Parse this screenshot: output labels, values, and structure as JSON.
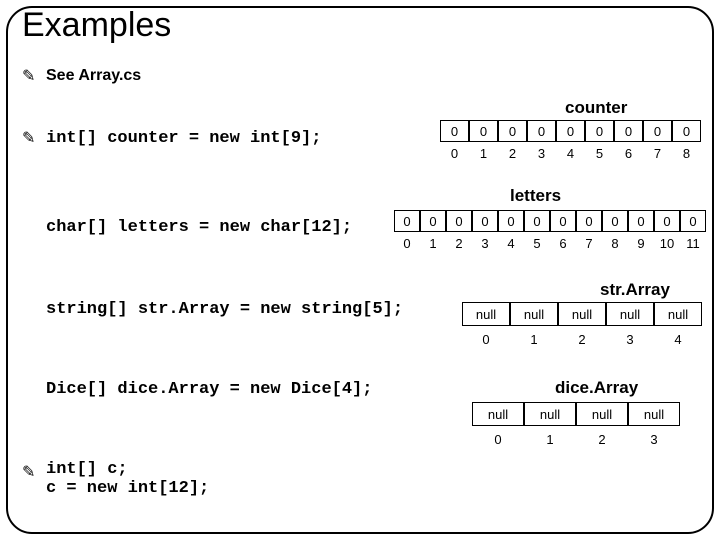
{
  "title": "Examples",
  "bullets": {
    "see": "See Array.cs",
    "code1": "int[] counter = new int[9];",
    "code2": "char[] letters = new char[12];",
    "code3": "string[] str.Array = new string[5];",
    "code4": "Dice[] dice.Array = new Dice[4];",
    "code5": "int[] c;\nc = new int[12];"
  },
  "arrays": {
    "counter": {
      "label": "counter",
      "cells": [
        "0",
        "0",
        "0",
        "0",
        "0",
        "0",
        "0",
        "0",
        "0"
      ],
      "indices": [
        "0",
        "1",
        "2",
        "3",
        "4",
        "5",
        "6",
        "7",
        "8"
      ]
    },
    "letters": {
      "label": "letters",
      "cells": [
        "0",
        "0",
        "0",
        "0",
        "0",
        "0",
        "0",
        "0",
        "0",
        "0",
        "0",
        "0"
      ],
      "indices": [
        "0",
        "1",
        "2",
        "3",
        "4",
        "5",
        "6",
        "7",
        "8",
        "9",
        "10",
        "11"
      ]
    },
    "strArray": {
      "label": "str.Array",
      "cells": [
        "null",
        "null",
        "null",
        "null",
        "null"
      ],
      "indices": [
        "0",
        "1",
        "2",
        "3",
        "4"
      ]
    },
    "diceArray": {
      "label": "dice.Array",
      "cells": [
        "null",
        "null",
        "null",
        "null"
      ],
      "indices": [
        "0",
        "1",
        "2",
        "3"
      ]
    }
  }
}
